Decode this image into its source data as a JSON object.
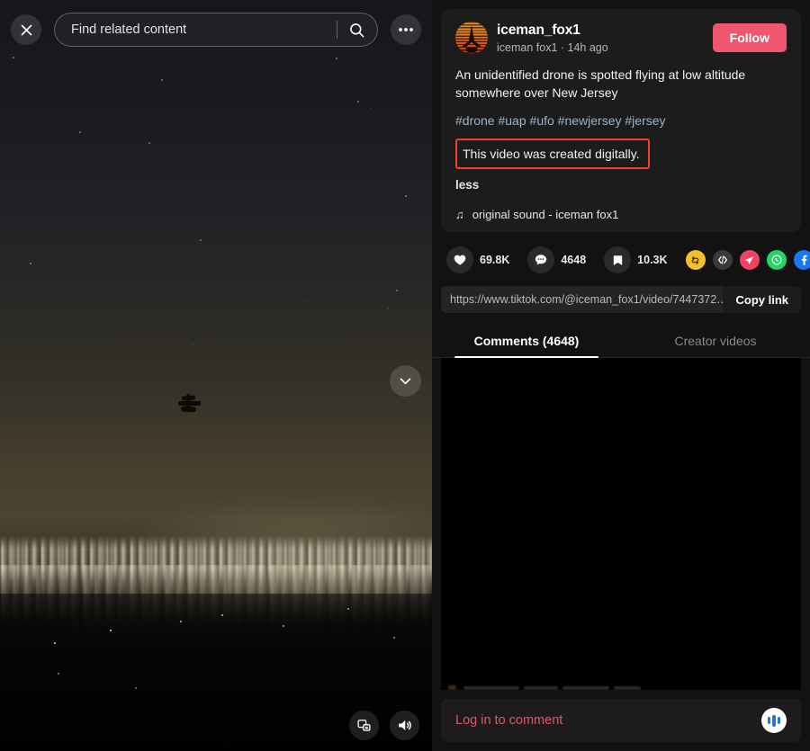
{
  "search": {
    "placeholder": "Find related content",
    "value": "",
    "close_label": "×",
    "more_label": "•••"
  },
  "video": {
    "next_label": "⌄",
    "pip_label": "picture-in-picture",
    "volume_label": "volume-on"
  },
  "post": {
    "author_name": "iceman_fox1",
    "author_subtitle": "iceman fox1 · 14h ago",
    "follow_label": "Follow",
    "description": "An unidentified drone is spotted flying at low altitude somewhere over New Jersey",
    "hashtags": [
      "#drone",
      "#uap",
      "#ufo",
      "#newjersey",
      "#jersey"
    ],
    "ai_disclosure": "This video was created digitally.",
    "ai_disclosure_border_color": "#f5402c",
    "less_label": "less",
    "sound_icon": "♫",
    "sound_name": "original sound - iceman fox1"
  },
  "actions": {
    "like_count": "69.8K",
    "comment_count": "4648",
    "bookmark_count": "10.3K",
    "share_targets": [
      {
        "name": "repost",
        "glyph": "⇄",
        "color": "#f2c02e"
      },
      {
        "name": "embed",
        "glyph": "</>",
        "color": "#3a3a3c"
      },
      {
        "name": "telegram",
        "glyph": "➤",
        "color": "#ee4462"
      },
      {
        "name": "whatsapp",
        "glyph": "",
        "color": "#25d366"
      },
      {
        "name": "facebook",
        "glyph": "f",
        "color": "#1877f2"
      },
      {
        "name": "share-more",
        "glyph": "➤",
        "color": "transparent"
      }
    ]
  },
  "link": {
    "url": "https://www.tiktok.com/@iceman_fox1/video/7447372…",
    "copy_label": "Copy link"
  },
  "tabs": [
    {
      "label": "Comments (4648)",
      "active": true
    },
    {
      "label": "Creator videos",
      "active": false
    }
  ],
  "login": {
    "prompt": "Log in to comment",
    "prompt_color": "#e0566b",
    "equalizer_label": "audio-equalizer"
  },
  "colors": {
    "accent_pink": "#f0566d",
    "panel_bg": "#121212",
    "card_bg": "#1c1c1c",
    "hashtag": "#9fb3c4"
  }
}
